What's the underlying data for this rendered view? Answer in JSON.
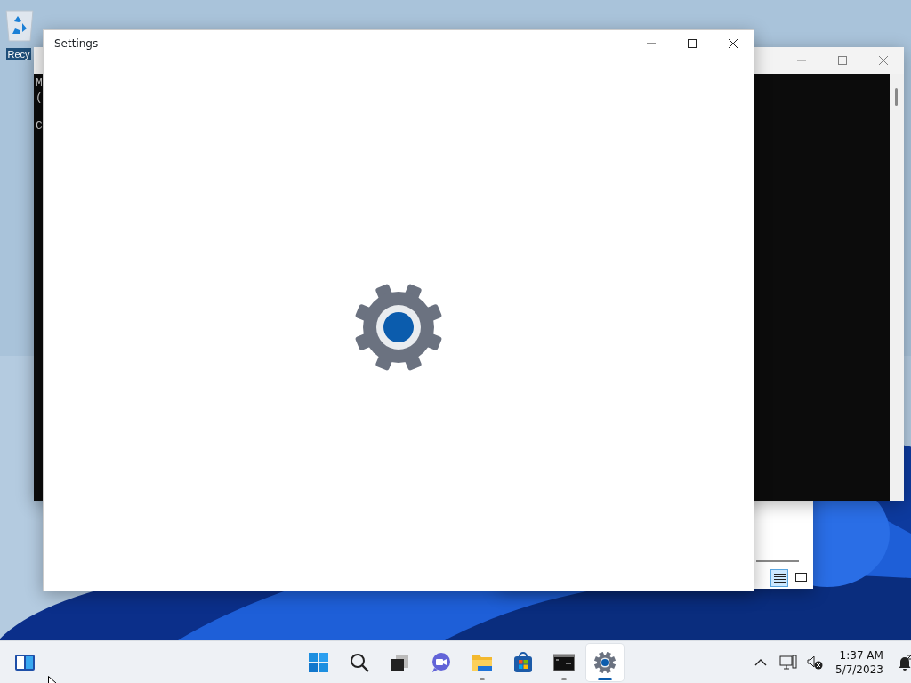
{
  "desktop": {
    "icons": [
      {
        "label": "Recy"
      }
    ]
  },
  "windows": [
    {
      "kind": "explorer",
      "view_buttons": [
        {
          "kind": "details",
          "selected": true
        },
        {
          "kind": "tiles",
          "selected": false
        }
      ]
    },
    {
      "kind": "console",
      "lines": [
        "M",
        "(",
        "C"
      ]
    },
    {
      "kind": "settings",
      "title": "Settings"
    }
  ],
  "taskbar": {
    "apps": [
      {
        "kind": "start",
        "running": false,
        "selected": false
      },
      {
        "kind": "search",
        "running": false,
        "selected": false
      },
      {
        "kind": "taskview",
        "running": false,
        "selected": false
      },
      {
        "kind": "chat",
        "running": false,
        "selected": false
      },
      {
        "kind": "explorer",
        "running": true,
        "selected": false
      },
      {
        "kind": "store",
        "running": false,
        "selected": false
      },
      {
        "kind": "terminal",
        "running": true,
        "selected": false
      },
      {
        "kind": "settings",
        "running": true,
        "selected": true
      }
    ],
    "clock": {
      "time": "1:37 AM",
      "date": "5/7/2023"
    }
  }
}
